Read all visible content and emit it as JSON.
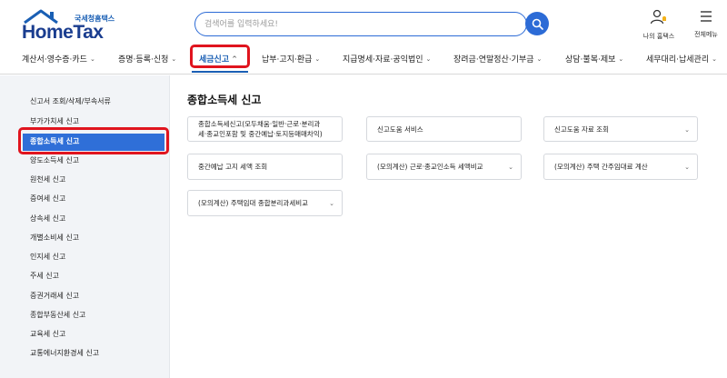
{
  "header": {
    "logo_sub": "국세청홈택스",
    "logo_main": "HomeTax",
    "search_placeholder": "검색어를 입력하세요!",
    "my_hometax": "나의 홈택스",
    "all_menu": "전체메뉴"
  },
  "nav": {
    "items": [
      {
        "label": "계산서·영수증·카드"
      },
      {
        "label": "증명·등록·신청"
      },
      {
        "label": "세금신고"
      },
      {
        "label": "납부·고지·환급"
      },
      {
        "label": "지급명세·자료·공익법인"
      },
      {
        "label": "장려금·연말정산·기부금"
      },
      {
        "label": "상담·불복·제보"
      },
      {
        "label": "세무대리·납세관리"
      }
    ],
    "active_index": 2
  },
  "sidebar": {
    "items": [
      {
        "label": "신고서 조회/삭제/부속서류"
      },
      {
        "label": "부가가치세 신고"
      },
      {
        "label": "종합소득세 신고"
      },
      {
        "label": "양도소득세 신고"
      },
      {
        "label": "원천세 신고"
      },
      {
        "label": "증여세 신고"
      },
      {
        "label": "상속세 신고"
      },
      {
        "label": "개별소비세 신고"
      },
      {
        "label": "인지세 신고"
      },
      {
        "label": "주세 신고"
      },
      {
        "label": "증권거래세 신고"
      },
      {
        "label": "종합부동산세 신고"
      },
      {
        "label": "교육세 신고"
      },
      {
        "label": "교통에너지환경세 신고"
      }
    ],
    "active_index": 2
  },
  "main": {
    "title": "종합소득세 신고",
    "cards": [
      {
        "line1": "종합소득세신고(모두채움·일반·근로·분리과",
        "line2": "세·종교인포함 및 중간예납·토지등매매차익)"
      },
      {
        "line1": "신고도움 서비스",
        "line2": ""
      },
      {
        "line1": "신고도움 자료 조회",
        "line2": ""
      },
      {
        "line1": "중간예납 고지 세액 조회",
        "line2": ""
      },
      {
        "line1": "(모의계산) 근로·종교인소득 세액비교",
        "line2": ""
      },
      {
        "line1": "(모의계산) 주택 간주임대료 계산",
        "line2": ""
      },
      {
        "line1": "(모의계산) 주택임대 종합분리과세비교",
        "line2": ""
      }
    ]
  },
  "colors": {
    "accent": "#2c6bd6",
    "highlight_red": "#e0141e",
    "sidebar_bg": "#f2f4f7"
  }
}
